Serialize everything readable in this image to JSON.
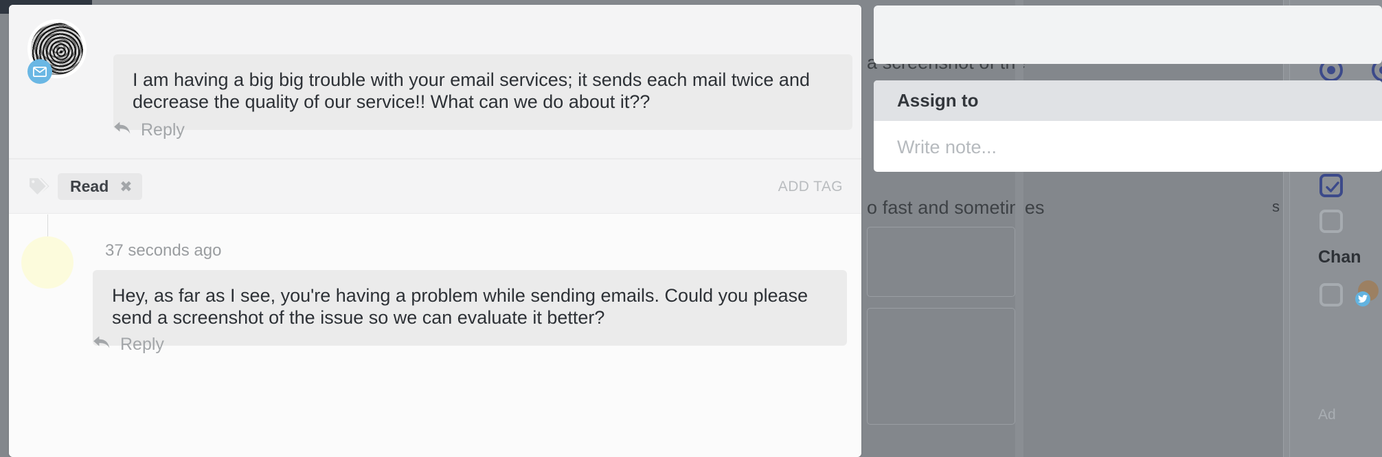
{
  "conversation": {
    "customer_message": {
      "avatar_name": "customer-avatar",
      "channel_badge": "email-icon",
      "text": "I am having a big big trouble with your email services; it sends each mail twice and decrease the quality of our service!! What can we do about it??",
      "reply_label": "Reply"
    },
    "tags": {
      "tag_icon": "tag-icon",
      "chips": [
        {
          "label": "Read",
          "remove": "✖"
        }
      ],
      "add_tag_label": "ADD TAG"
    },
    "agent_message": {
      "timestamp": "37 seconds ago",
      "text": "Hey, as far as I see, you're having a problem while sending emails. Could you please send a screenshot of the issue so we can evaluate it better?",
      "reply_label": "Reply"
    }
  },
  "popover": {
    "assign_label": "Assign to",
    "note_placeholder": "Write note..."
  },
  "background": {
    "ghost_line_1": "a screenshot of the",
    "ghost_line_2": "o fast and sometimes",
    "rail_heading": "Chan",
    "rail_fragment": "s",
    "rail_add": "Ad"
  },
  "colors": {
    "accent_blue": "#6ab7e4",
    "control_blue": "#3c4a8a",
    "card_bg": "#fafafa",
    "bubble_bg": "#ebebeb",
    "backdrop": "#83878c",
    "avatar_yellow": "#fcfbdc"
  }
}
